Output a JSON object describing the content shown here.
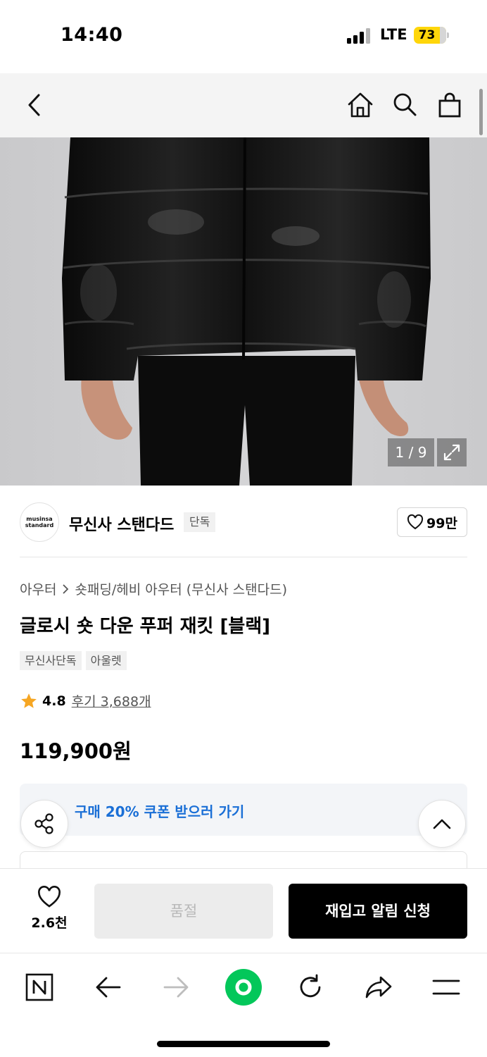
{
  "status_bar": {
    "time": "14:40",
    "network": "LTE",
    "battery": "73"
  },
  "hero": {
    "counter": "1 / 9"
  },
  "brand": {
    "logo_line1": "musinsa",
    "logo_line2": "standard",
    "name": "무신사 스탠다드",
    "exclusive_badge": "단독",
    "like_count": "99만"
  },
  "product": {
    "breadcrumb": [
      "아우터",
      "숏패딩/헤비 아우터 (무신사 스탠다드)"
    ],
    "title": "글로시 숏 다운 푸퍼 재킷 [블랙]",
    "tags": [
      "무신사단독",
      "아울렛"
    ],
    "rating": "4.8",
    "review_link": "후기 3,688개",
    "price": "119,900원"
  },
  "coupon": {
    "text": "구매 20% 쿠폰 받으러 가기"
  },
  "purchase_bar": {
    "wish_count": "2.6천",
    "soldout_label": "품절",
    "restock_label": "재입고 알림 신청"
  },
  "colors": {
    "accent_blue": "#1a6fd6",
    "battery_yellow": "#ffd60a",
    "naver_green": "#03c75a"
  },
  "icons": [
    "back-icon",
    "home-icon",
    "search-icon",
    "bag-icon",
    "expand-icon",
    "heart-icon",
    "star-icon",
    "share-icon",
    "chevron-up-icon",
    "naver-icon",
    "arrow-left-icon",
    "arrow-right-icon",
    "green-dot-icon",
    "refresh-icon",
    "forward-share-icon",
    "menu-icon"
  ]
}
